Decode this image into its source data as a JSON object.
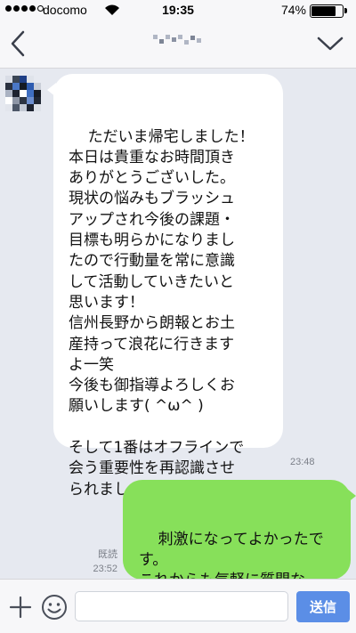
{
  "status_bar": {
    "carrier": "docomo",
    "time": "19:35",
    "battery": "74%",
    "battery_level": 0.74,
    "signal_bars_filled": 4,
    "signal_bars_total": 5
  },
  "header": {
    "back_icon": "chevron-left-icon",
    "menu_icon": "chevron-down-icon"
  },
  "messages": [
    {
      "direction": "incoming",
      "text": "ただいま帰宅しました！\n本日は貴重なお時間頂き\nありがとうございした。\n現状の悩みもブラッシュ\nアップされ今後の課題・\n目標も明らかになりまし\nたので行動量を常に意識\nして活動していきたいと\n思います！\n信州長野から朗報とお土\n産持って浪花に行きます\nよ一笑\n今後も御指導よろしくお\n願いします( ^ω^ )\n\nそして1番はオフラインで\n会う重要性を再認識させ\nられました。",
      "time": "23:48"
    },
    {
      "direction": "outgoing",
      "text": "刺激になってよかったで\nす。\nこれからも気軽に質問な\nどしてくださいね",
      "read_label": "既読",
      "time": "23:52"
    }
  ],
  "input_bar": {
    "placeholder": "",
    "send_label": "送信"
  },
  "colors": {
    "chat_background": "#e6e9f0",
    "outgoing_bubble": "#87e05a",
    "send_button": "#5b8ee6"
  }
}
